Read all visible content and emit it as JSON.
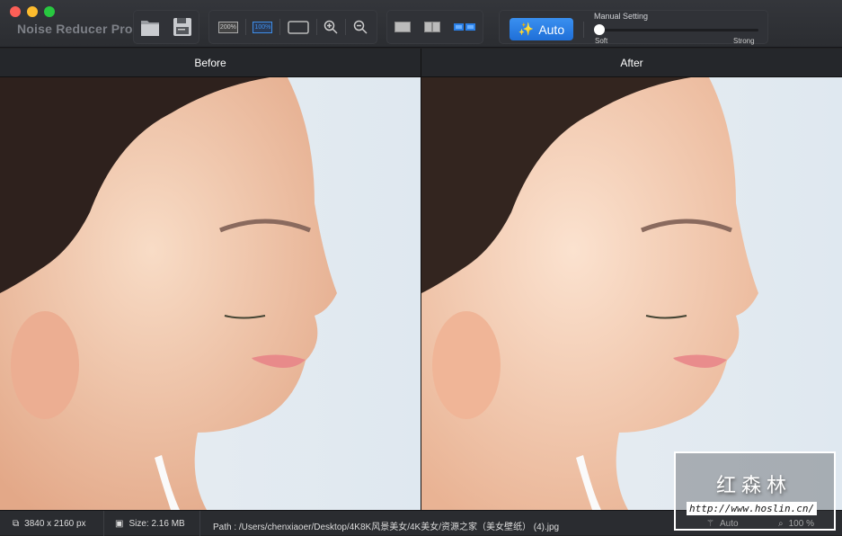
{
  "app": {
    "title": "Noise Reducer Pro"
  },
  "toolbar": {
    "zoom_200": "200%",
    "zoom_100": "100%",
    "auto_label": "Auto",
    "manual_setting": "Manual Setting",
    "slider": {
      "min_label": "Soft",
      "max_label": "Strong",
      "value": 0
    }
  },
  "panes": {
    "before": "Before",
    "after": "After"
  },
  "status": {
    "dimensions": "3840 x 2160 px",
    "size": "Size: 2.16 MB",
    "path": "Path : /Users/chenxiaoer/Desktop/4K8K风景美女/4K美女/资源之家（美女壁纸） (4).jpg",
    "mode": "Auto",
    "zoom": "100 %"
  },
  "watermark": {
    "text": "红森林",
    "url": "http://www.hoslin.cn/"
  },
  "colors": {
    "accent": "#2a7fe6",
    "toolbar": "#2f3135"
  }
}
